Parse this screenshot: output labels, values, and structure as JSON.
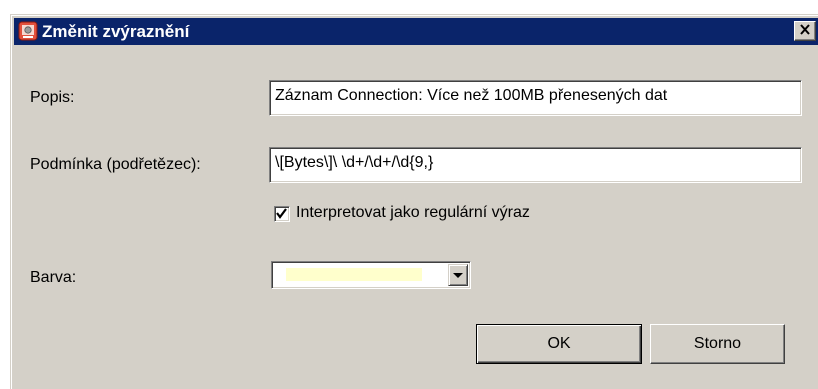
{
  "dialog": {
    "title": "Změnit zvýraznění",
    "close_symbol": "×",
    "app_icon": "app-icon",
    "close_icon": "close-icon"
  },
  "form": {
    "description_label": "Popis:",
    "description_value": "Záznam Connection: Více než 100MB přenesených dat",
    "condition_label": "Podmínka (podřetězec):",
    "condition_value": "\\[Bytes\\]\\ \\d+/\\d+/\\d{9,}",
    "regex_checkbox_label": "Interpretovat jako regulární výraz",
    "regex_checked": true,
    "color_label": "Barva:",
    "color_value": "#ffffcc"
  },
  "buttons": {
    "ok_label": "OK",
    "cancel_label": "Storno"
  },
  "colors": {
    "titlebar": "#0a246a",
    "dialog_bg": "#d4d0c8",
    "highlight_swatch": "#ffffcc"
  }
}
